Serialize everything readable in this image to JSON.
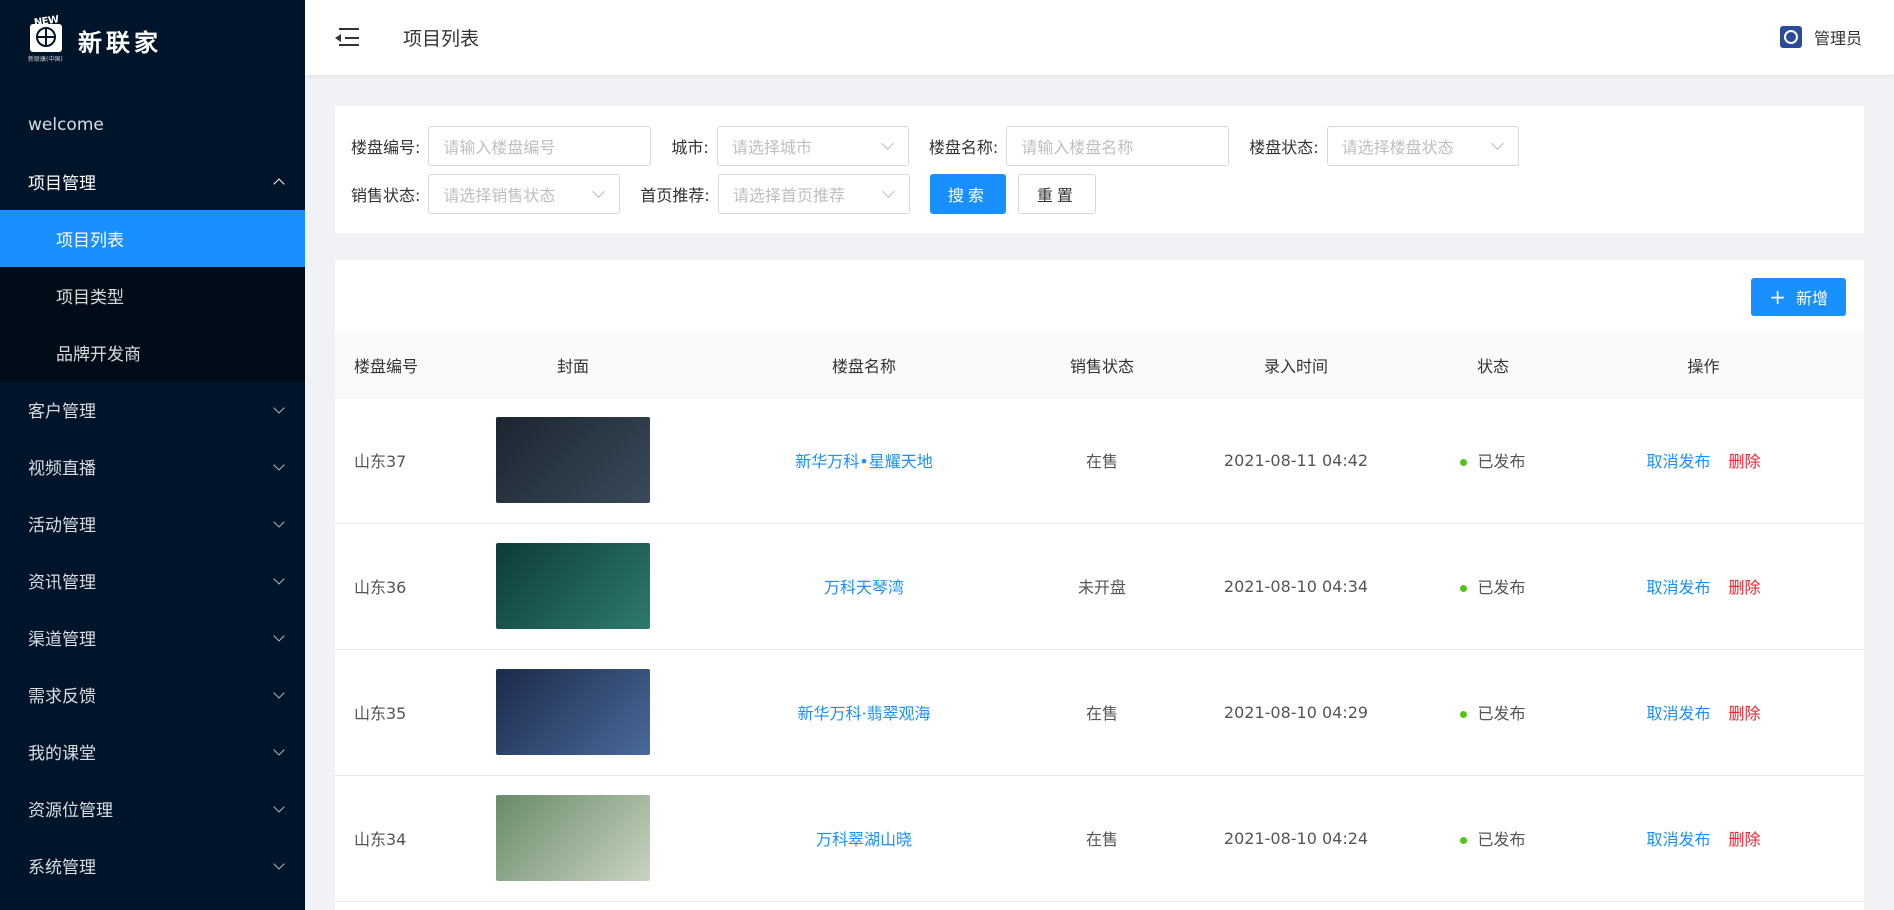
{
  "brand": {
    "name": "新联家",
    "mark_text": "NEW",
    "sub_text": "新联康(中国)"
  },
  "sidebar": {
    "items": [
      {
        "label": "welcome"
      },
      {
        "label": "项目管理",
        "open": true,
        "children": [
          {
            "label": "项目列表",
            "active": true
          },
          {
            "label": "项目类型"
          },
          {
            "label": "品牌开发商"
          }
        ]
      },
      {
        "label": "客户管理"
      },
      {
        "label": "视频直播"
      },
      {
        "label": "活动管理"
      },
      {
        "label": "资讯管理"
      },
      {
        "label": "渠道管理"
      },
      {
        "label": "需求反馈"
      },
      {
        "label": "我的课堂"
      },
      {
        "label": "资源位管理"
      },
      {
        "label": "系统管理"
      }
    ]
  },
  "header": {
    "title": "项目列表",
    "user": "管理员"
  },
  "filters": {
    "code_label": "楼盘编号:",
    "code_placeholder": "请输入楼盘编号",
    "city_label": "城市:",
    "city_placeholder": "请选择城市",
    "name_label": "楼盘名称:",
    "name_placeholder": "请输入楼盘名称",
    "status_label": "楼盘状态:",
    "status_placeholder": "请选择楼盘状态",
    "sale_label": "销售状态:",
    "sale_placeholder": "请选择销售状态",
    "recommend_label": "首页推荐:",
    "recommend_placeholder": "请选择首页推荐",
    "search_button": "搜索",
    "reset_button": "重置"
  },
  "table": {
    "add_button": "新增",
    "columns": [
      "楼盘编号",
      "封面",
      "楼盘名称",
      "销售状态",
      "录入时间",
      "状态",
      "操作"
    ],
    "rows": [
      {
        "code": "山东37",
        "name": "新华万科•星耀天地",
        "sale_status": "在售",
        "time": "2021-08-11 04:42",
        "status": "已发布",
        "action1": "取消发布",
        "action2": "删除",
        "cover_colors": [
          "#1b2530",
          "#3a4a5a"
        ]
      },
      {
        "code": "山东36",
        "name": "万科天琴湾",
        "sale_status": "未开盘",
        "time": "2021-08-10 04:34",
        "status": "已发布",
        "action1": "取消发布",
        "action2": "删除",
        "cover_colors": [
          "#0d3b3a",
          "#2e7a6e"
        ]
      },
      {
        "code": "山东35",
        "name": "新华万科·翡翠观海",
        "sale_status": "在售",
        "time": "2021-08-10 04:29",
        "status": "已发布",
        "action1": "取消发布",
        "action2": "删除",
        "cover_colors": [
          "#1c2a4a",
          "#4a6a9a"
        ]
      },
      {
        "code": "山东34",
        "name": "万科翠湖山晓",
        "sale_status": "在售",
        "time": "2021-08-10 04:24",
        "status": "已发布",
        "action1": "取消发布",
        "action2": "删除",
        "cover_colors": [
          "#6a8a6a",
          "#c8d4c0"
        ]
      }
    ]
  }
}
